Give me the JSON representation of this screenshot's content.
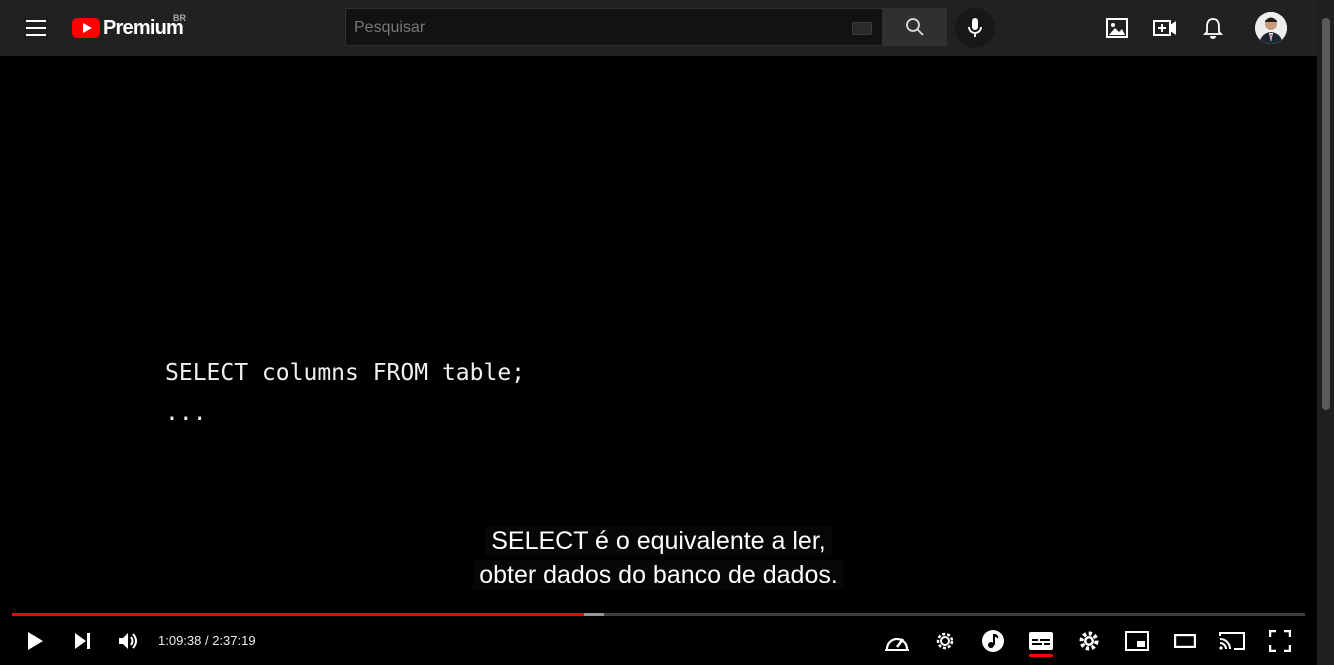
{
  "header": {
    "logo_text": "Premium",
    "region_badge": "BR",
    "search": {
      "placeholder": "Pesquisar",
      "value": ""
    }
  },
  "video": {
    "code_lines": [
      "SELECT columns FROM table;",
      "..."
    ],
    "caption_lines": [
      "SELECT é o equivalente a ler,",
      "obter dados do banco de dados."
    ]
  },
  "player": {
    "time_display": "1:09:38 / 2:37:19",
    "progress_played_fraction": 0.4426,
    "progress_buffered_fraction": 0.4581,
    "subtitles_on": true
  },
  "colors": {
    "accent": "#ff0000",
    "topbar": "#212121",
    "background": "#000000"
  },
  "icons": [
    "menu-icon",
    "youtube-logo-icon",
    "keyboard-icon",
    "search-icon",
    "mic-icon",
    "image-icon",
    "create-video-icon",
    "bell-icon",
    "avatar",
    "play-icon",
    "next-icon",
    "volume-icon",
    "speed-icon",
    "gear-badge-icon",
    "music-icon",
    "subtitles-icon",
    "settings-icon",
    "miniplayer-icon",
    "theater-icon",
    "cast-icon",
    "fullscreen-icon"
  ]
}
